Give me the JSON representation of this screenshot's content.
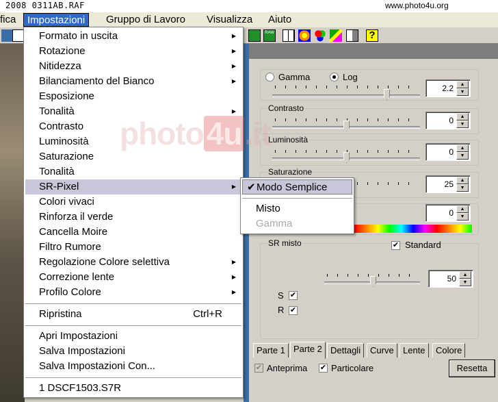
{
  "titlebar": {
    "filename": "2008  0311AB.RAF",
    "website": "www.photo4u.org"
  },
  "menubar": {
    "items": [
      "fica",
      "Impostazioni",
      "Gruppo di Lavoro",
      "Visualizza",
      "Aiuto"
    ]
  },
  "dropdown": {
    "items": [
      {
        "label": "Formato in uscita",
        "submenu": true
      },
      {
        "label": "Rotazione",
        "submenu": true
      },
      {
        "label": "Nitidezza",
        "submenu": true
      },
      {
        "label": "Bilanciamento del Bianco",
        "submenu": true
      },
      {
        "label": "Esposizione",
        "submenu": false
      },
      {
        "label": "Tonalità",
        "submenu": true
      },
      {
        "label": "Contrasto",
        "submenu": false
      },
      {
        "label": "Luminosità",
        "submenu": false
      },
      {
        "label": "Saturazione",
        "submenu": false
      },
      {
        "label": "Tonalità",
        "submenu": false
      },
      {
        "label": "SR-Pixel",
        "submenu": true,
        "highlighted": true
      },
      {
        "label": "Colori vivaci",
        "submenu": false
      },
      {
        "label": "Rinforza il verde",
        "submenu": false
      },
      {
        "label": "Cancella Moire",
        "submenu": false
      },
      {
        "label": "Filtro Rumore",
        "submenu": false
      },
      {
        "label": "Regolazione Colore selettiva",
        "submenu": true
      },
      {
        "label": "Correzione lente",
        "submenu": true
      },
      {
        "label": "Profilo Colore",
        "submenu": true
      }
    ],
    "reset": {
      "label": "Ripristina",
      "shortcut": "Ctrl+R"
    },
    "file_items": [
      "Apri Impostazioni",
      "Salva Impostazioni",
      "Salva Impostazioni Con..."
    ],
    "recent": "1 DSCF1503.S7R",
    "watermark": {
      "left": "photo",
      "mid": "4u",
      "right": ".it"
    }
  },
  "submenu": {
    "items": [
      {
        "label": "Modo Semplice",
        "checked": true,
        "disabled": false
      },
      {
        "label": "Misto",
        "checked": false,
        "disabled": false
      },
      {
        "label": "Gamma",
        "checked": false,
        "disabled": true
      }
    ]
  },
  "panel": {
    "gamma_label": "Gamma",
    "log_label": "Log",
    "gamma_value": "2.2",
    "contrast_label": "Contrasto",
    "contrast_value": "0",
    "luminosity_label": "Luminosità",
    "luminosity_value": "0",
    "saturation_label": "Saturazione",
    "saturation_value": "25",
    "hue_value": "0",
    "sr_label": "SR misto",
    "standard_label": "Standard",
    "sr_value": "50",
    "s_label": "S",
    "r_label": "R",
    "tabs": [
      "Parte 1",
      "Parte 2",
      "Dettagli",
      "Curve",
      "Lente",
      "Colore"
    ],
    "preview_label": "Anteprima",
    "detail_label": "Particolare",
    "reset_button": "Resetta"
  }
}
